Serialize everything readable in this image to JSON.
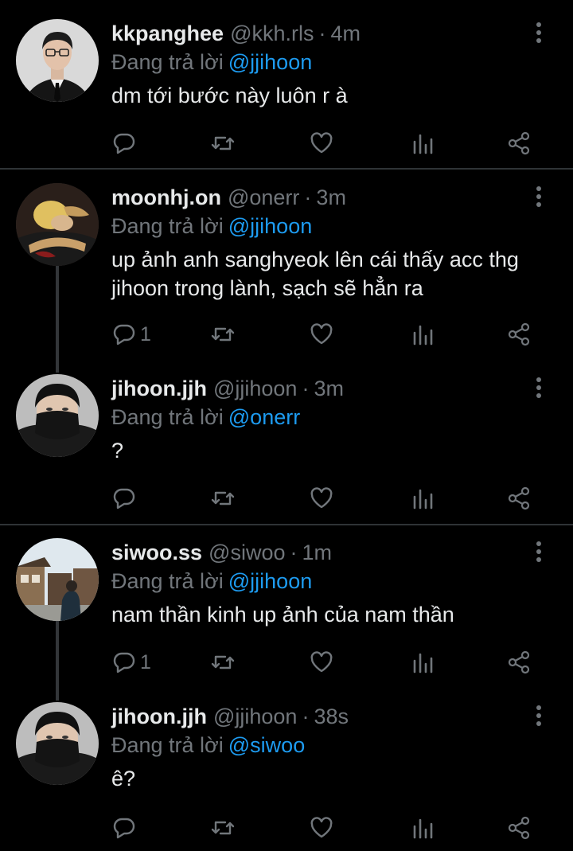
{
  "replying_label": "Đang trả lời",
  "tweets": [
    {
      "name": "kkpanghee",
      "handle": "@kkh.rls",
      "time": "4m",
      "replying_to": "@jjihoon",
      "text": "dm tới bước này luôn r à",
      "reply_count": "",
      "avatar": "man-in-suit"
    },
    {
      "name": "moonhj.on",
      "handle": "@onerr",
      "time": "3m",
      "replying_to": "@jjihoon",
      "text": "up ảnh anh sanghyeok lên cái thấy acc thg jihoon trong lành, sạch sẽ hẳn ra",
      "reply_count": "1",
      "avatar": "blond-person"
    },
    {
      "name": "jihoon.jjh",
      "handle": "@jjihoon",
      "time": "3m",
      "replying_to": "@onerr",
      "text": "?",
      "reply_count": "",
      "avatar": "masked-person"
    },
    {
      "name": "siwoo.ss",
      "handle": "@siwoo",
      "time": "1m",
      "replying_to": "@jjihoon",
      "text": "nam thần kinh up ảnh của nam thần",
      "reply_count": "1",
      "avatar": "street-photo"
    },
    {
      "name": "jihoon.jjh",
      "handle": "@jjihoon",
      "time": "38s",
      "replying_to": "@siwoo",
      "text": "ê?",
      "reply_count": "",
      "avatar": "masked-person"
    }
  ],
  "colors": {
    "background": "#000000",
    "text": "#e7e9ea",
    "muted": "#71767b",
    "link": "#1d9bf0"
  }
}
